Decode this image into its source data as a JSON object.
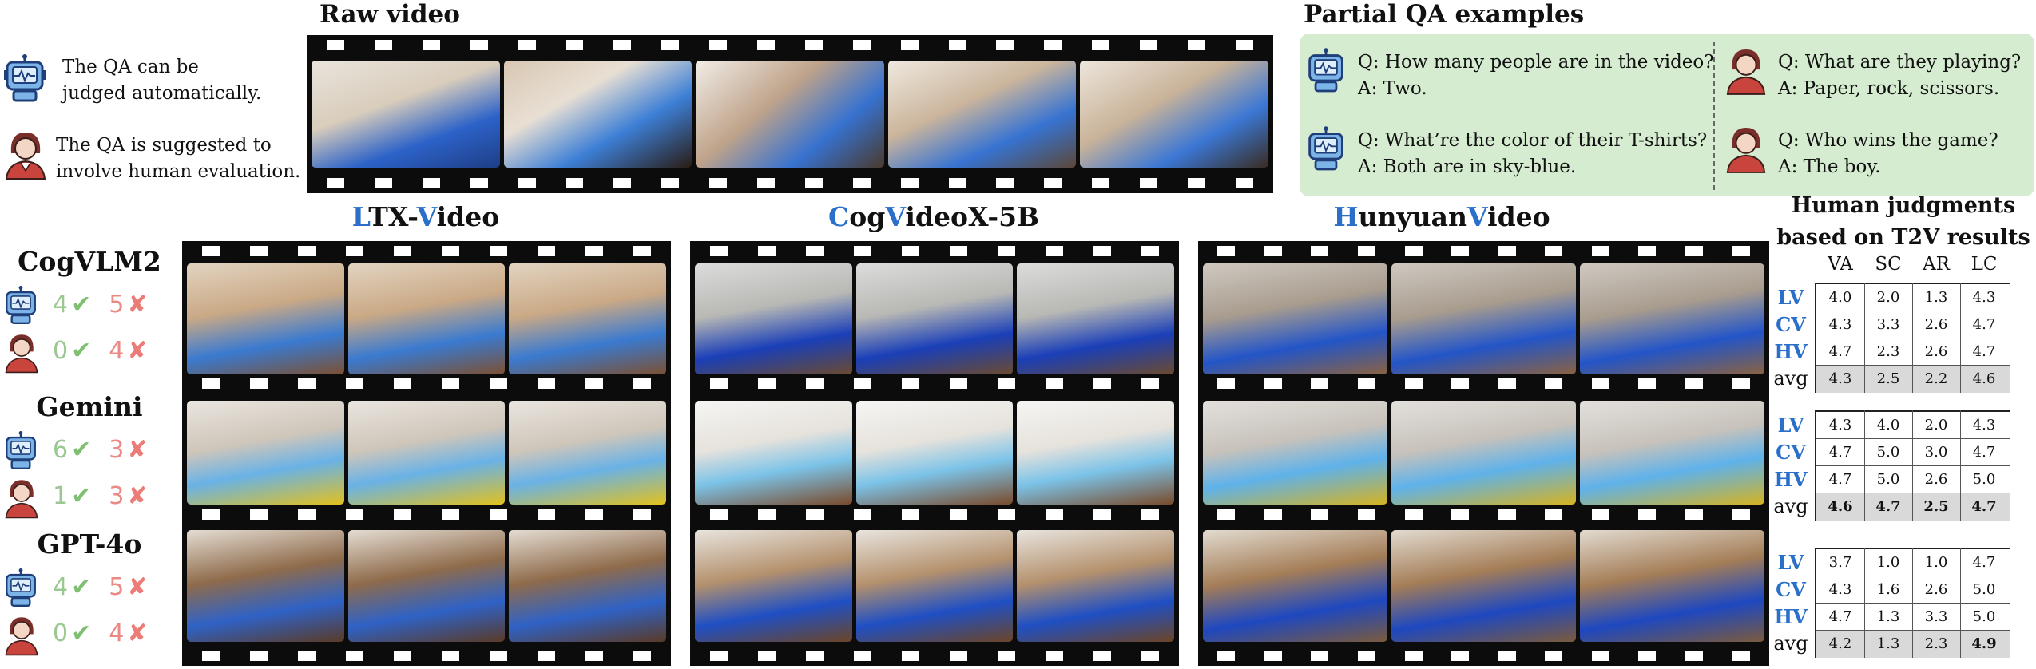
{
  "headings": {
    "raw_video": "Raw video",
    "partial_qa": "Partial QA examples",
    "human_judgments_line1": "Human judgments",
    "human_judgments_line2": "based on T2V results"
  },
  "legend": {
    "auto": "The QA can be judged automatically.",
    "auto_line1": "The QA can be",
    "auto_line2": "judged automatically.",
    "human_line1": "The QA is suggested to",
    "human_line2": "involve human evaluation.",
    "robot_icon": "robot-icon",
    "human_icon": "human-evaluator-icon"
  },
  "qa": {
    "q1": "Q: How many people are in the video?",
    "a1": "A: Two.",
    "q2": "Q: What’re the color of their T-shirts?",
    "a2": "A: Both are in sky-blue.",
    "q3": "Q: What are they playing?",
    "a3": "A: Paper, rock, scissors.",
    "q4": "Q: Who wins the game?",
    "a4": "A: The boy."
  },
  "models": [
    {
      "initial1": "L",
      "rest1": "TX-",
      "initial2": "V",
      "rest2": "ideo"
    },
    {
      "initial1": "C",
      "rest1": "og",
      "initial2": "V",
      "rest2": "ideoX-5B"
    },
    {
      "initial1": "H",
      "rest1": "unyuan",
      "initial2": "V",
      "rest2": "ideo"
    }
  ],
  "judges": [
    {
      "name": "CogVLM2",
      "auto_correct": "4",
      "auto_wrong": "5",
      "human_correct": "0",
      "human_wrong": "4"
    },
    {
      "name": "Gemini",
      "auto_correct": "6",
      "auto_wrong": "3",
      "human_correct": "1",
      "human_wrong": "3"
    },
    {
      "name": "GPT-4o",
      "auto_correct": "4",
      "auto_wrong": "5",
      "human_correct": "0",
      "human_wrong": "4"
    }
  ],
  "table": {
    "columns": [
      "VA",
      "SC",
      "AR",
      "LC"
    ],
    "row_labels": [
      "LV",
      "CV",
      "HV"
    ],
    "avg_label": "avg",
    "blocks": [
      {
        "rows": [
          [
            "4.0",
            "2.0",
            "1.3",
            "4.3"
          ],
          [
            "4.3",
            "3.3",
            "2.6",
            "4.7"
          ],
          [
            "4.7",
            "2.3",
            "2.6",
            "4.7"
          ]
        ],
        "avg": [
          "4.3",
          "2.5",
          "2.2",
          "4.6"
        ]
      },
      {
        "rows": [
          [
            "4.3",
            "4.0",
            "2.0",
            "4.3"
          ],
          [
            "4.7",
            "5.0",
            "3.0",
            "4.7"
          ],
          [
            "4.7",
            "5.0",
            "2.6",
            "5.0"
          ]
        ],
        "avg": [
          "4.6",
          "4.7",
          "2.5",
          "4.7"
        ]
      },
      {
        "rows": [
          [
            "3.7",
            "1.0",
            "1.0",
            "4.7"
          ],
          [
            "4.3",
            "1.6",
            "2.6",
            "5.0"
          ],
          [
            "4.7",
            "1.3",
            "3.3",
            "5.0"
          ]
        ],
        "avg": [
          "4.2",
          "1.3",
          "2.3",
          "4.9"
        ]
      }
    ]
  },
  "colors": {
    "accent_blue": "#2a6fc9",
    "check_green": "#7fbf72",
    "cross_red": "#ec7c77",
    "qa_panel": "#d6ecd0",
    "avg_gray": "#d9d9d9"
  }
}
